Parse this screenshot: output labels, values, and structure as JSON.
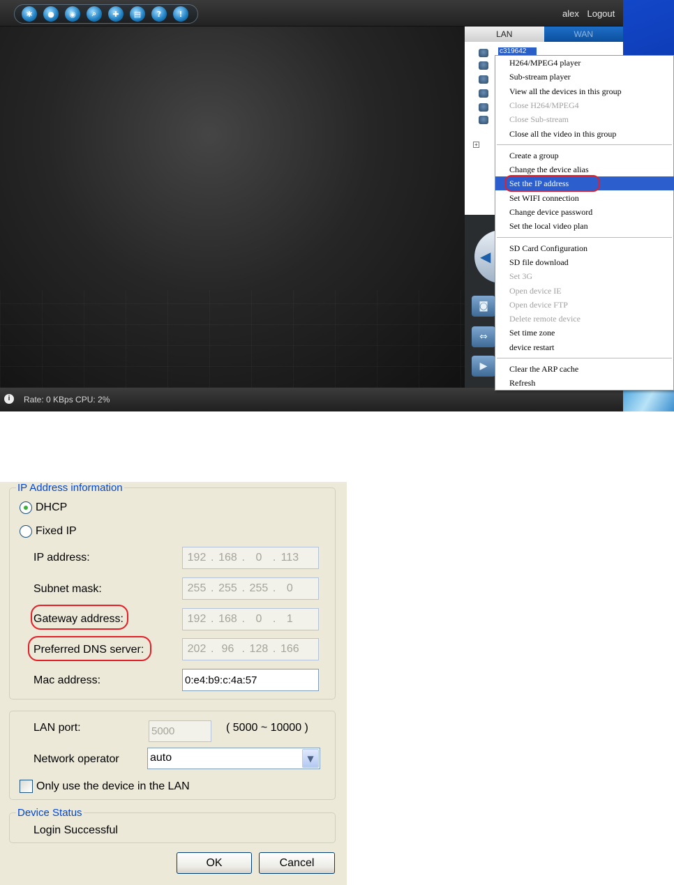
{
  "app": {
    "toolbar_icons": [
      "grid-icon",
      "record-icon",
      "camera-icon",
      "search-icon",
      "lock-icon",
      "save-icon",
      "help-icon",
      "info-icon"
    ],
    "toolbar_glyphs": [
      "✱",
      "●",
      "◉",
      "⌕",
      "✚",
      "▤",
      "?",
      "!"
    ],
    "user": "alex",
    "logout": "Logout",
    "tabs": {
      "lan": "LAN",
      "wan": "WAN"
    },
    "tree_selected": "c319642",
    "status_text": "Rate: 0 KBps  CPU:  2%",
    "context_menu": {
      "items": [
        {
          "label": "H264/MPEG4 player",
          "enabled": true
        },
        {
          "label": "Sub-stream player",
          "enabled": true
        },
        {
          "label": "View all the devices in this group",
          "enabled": true
        },
        {
          "label": "Close H264/MPEG4",
          "enabled": false
        },
        {
          "label": "Close Sub-stream",
          "enabled": false
        },
        {
          "label": "Close all the video in this group",
          "enabled": true
        },
        {
          "label": "Create a group",
          "enabled": true
        },
        {
          "label": "Change the device alias",
          "enabled": true
        },
        {
          "label": "Set the IP address",
          "enabled": true,
          "highlighted": true
        },
        {
          "label": "Set WIFI connection",
          "enabled": true
        },
        {
          "label": "Change device password",
          "enabled": true
        },
        {
          "label": "Set the local video plan",
          "enabled": true
        },
        {
          "label": "SD Card Configuration",
          "enabled": true
        },
        {
          "label": "SD file download",
          "enabled": true
        },
        {
          "label": "Set 3G",
          "enabled": false
        },
        {
          "label": "Open device IE",
          "enabled": false
        },
        {
          "label": "Open device FTP",
          "enabled": false
        },
        {
          "label": "Delete remote device",
          "enabled": false
        },
        {
          "label": "Set time zone",
          "enabled": true
        },
        {
          "label": "device restart",
          "enabled": true
        },
        {
          "label": "Clear the ARP cache",
          "enabled": true
        },
        {
          "label": "Refresh",
          "enabled": true
        }
      ]
    },
    "colors": {
      "menu_highlight": "#2c5fcd",
      "annotation_ring": "#e41e27"
    }
  },
  "dialog": {
    "ip_group_title": "IP Address information",
    "dhcp_label": "DHCP",
    "dhcp_checked": true,
    "fixed_label": "Fixed IP",
    "fixed_checked": false,
    "ip_label": "IP address:",
    "ip_value": [
      "192",
      "168",
      "0",
      "113"
    ],
    "mask_label": "Subnet mask:",
    "mask_value": [
      "255",
      "255",
      "255",
      "0"
    ],
    "gateway_label": "Gateway address:",
    "gateway_value": [
      "192",
      "168",
      "0",
      "1"
    ],
    "dns_label": "Preferred DNS server:",
    "dns_value": [
      "202",
      "96",
      "128",
      "166"
    ],
    "mac_label": "Mac address:",
    "mac_value": "0:e4:b9:c:4a:57",
    "lan_port_label": "LAN port:",
    "lan_port_value": "5000",
    "lan_port_range": "( 5000 ~ 10000 )",
    "operator_label": "Network operator",
    "operator_value": "auto",
    "lan_only_label": "Only use the device in the LAN",
    "lan_only_checked": false,
    "status_group_title": "Device Status",
    "status_value": "Login Successful",
    "ok": "OK",
    "cancel": "Cancel",
    "colors": {
      "group_title": "#0046d5",
      "dialog_bg": "#ece9d8"
    }
  }
}
